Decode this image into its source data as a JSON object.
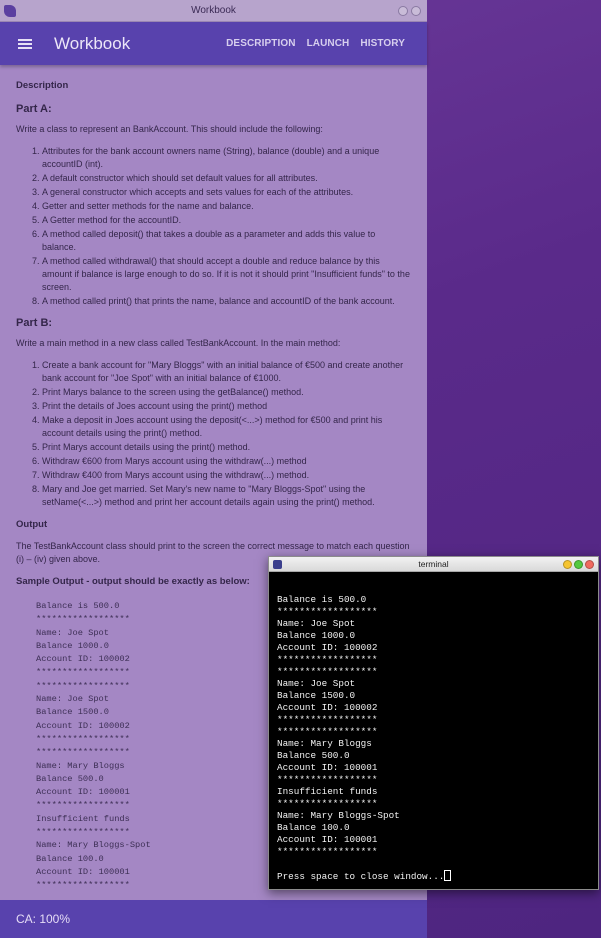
{
  "window": {
    "title": "Workbook"
  },
  "appbar": {
    "title": "Workbook",
    "nav": [
      "DESCRIPTION",
      "LAUNCH",
      "HISTORY"
    ]
  },
  "content": {
    "description_label": "Description",
    "partA": {
      "title": "Part A:",
      "intro": "Write a class to represent an BankAccount. This should include the following:",
      "items": [
        "Attributes for the bank account owners name (String), balance (double) and a unique accountID (int).",
        "A default constructor which should set default values for all attributes.",
        "A general constructor which accepts and sets values for each of the attributes.",
        "Getter and setter methods for the name and balance.",
        "A Getter method for the accountID.",
        "A method called deposit() that takes a double as a parameter and adds this value to balance.",
        "A method called withdrawal() that should accept a double and reduce balance by this amount if balance is large enough to do so. If it is not it should print \"Insufficient funds\" to the screen.",
        "A method called print() that prints the name, balance and accountID of the bank account."
      ]
    },
    "partB": {
      "title": "Part B:",
      "intro": "Write a main method in a new class called TestBankAccount. In the main method:",
      "items": [
        "Create a bank account for \"Mary Bloggs\" with an initial balance of €500 and create another bank account for \"Joe Spot\" with an initial balance of €1000.",
        "Print Marys balance to the screen using the getBalance() method.",
        "Print the details of Joes account using the print() method",
        "Make a deposit in Joes account using the deposit(<...>) method for €500 and print his account details using the print() method.",
        "Print Marys account details using the print() method.",
        "Withdraw €600 from Marys account using the withdraw(...) method",
        "Withdraw €400 from Marys account using the withdraw(...) method.",
        "Mary and Joe get married. Set Mary's new name to \"Mary Bloggs-Spot\" using the setName(<...>) method and print her account details again using the print() method."
      ]
    },
    "output_title": "Output",
    "output_text": "The TestBankAccount class should print to the screen the correct message to match each question (i) – (iv) given above.",
    "sample_title": "Sample Output - output should be exactly as below:",
    "sample_lines": [
      "Balance is 500.0",
      "******************",
      "Name: Joe Spot",
      "Balance 1000.0",
      "Account ID: 100002",
      "******************",
      "******************",
      "Name: Joe Spot",
      "Balance 1500.0",
      "Account ID: 100002",
      "******************",
      "******************",
      "Name: Mary Bloggs",
      "Balance 500.0",
      "Account ID: 100001",
      "******************",
      "Insufficient funds",
      "******************",
      "Name: Mary Bloggs-Spot",
      "Balance 100.0",
      "Account ID: 100001",
      "******************"
    ]
  },
  "footer": {
    "status": "CA: 100%"
  },
  "terminal": {
    "title": "terminal",
    "lines": [
      "Balance is 500.0",
      "******************",
      "Name: Joe Spot",
      "Balance 1000.0",
      "Account ID: 100002",
      "******************",
      "******************",
      "Name: Joe Spot",
      "Balance 1500.0",
      "Account ID: 100002",
      "******************",
      "******************",
      "Name: Mary Bloggs",
      "Balance 500.0",
      "Account ID: 100001",
      "******************",
      "Insufficient funds",
      "******************",
      "Name: Mary Bloggs-Spot",
      "Balance 100.0",
      "Account ID: 100001",
      "******************",
      "",
      "Press space to close window..."
    ],
    "dot_colors": [
      "#f5c431",
      "#53c93f",
      "#f06a5f"
    ]
  }
}
